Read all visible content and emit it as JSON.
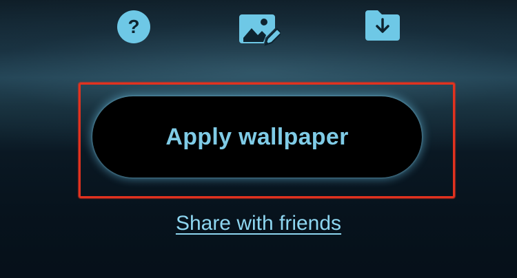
{
  "toolbar": {
    "icons": [
      {
        "name": "help-icon",
        "glyph": "?"
      },
      {
        "name": "edit-image-icon"
      },
      {
        "name": "download-folder-icon"
      }
    ]
  },
  "actions": {
    "apply_label": "Apply wallpaper",
    "share_label": "Share with friends"
  },
  "colors": {
    "accent": "#6ec8e6",
    "link": "#8ed6f0",
    "highlight": "#e2321f",
    "button_bg": "#000000"
  }
}
